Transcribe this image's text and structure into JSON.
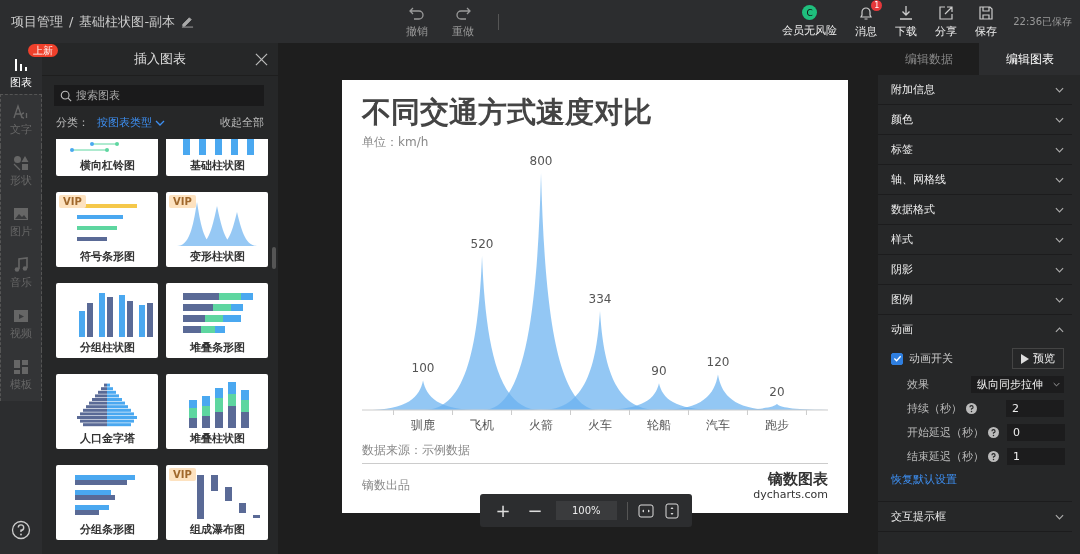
{
  "topbar": {
    "breadcrumb": [
      "项目管理",
      "基础柱状图-副本"
    ],
    "separator": "/",
    "history": [
      {
        "label": "撤销",
        "kind": "undo"
      },
      {
        "label": "重做",
        "kind": "redo"
      }
    ],
    "member": {
      "avatar": "C",
      "label": "会员无风险"
    },
    "actions": [
      {
        "label": "消息",
        "kind": "bell",
        "badge": "1"
      },
      {
        "label": "下载",
        "kind": "download"
      },
      {
        "label": "分享",
        "kind": "share"
      },
      {
        "label": "保存",
        "kind": "save"
      }
    ],
    "save_status": "22:36已保存"
  },
  "rail": {
    "badge": "上新",
    "items": [
      {
        "label": "图表",
        "kind": "chart",
        "selected": true
      },
      {
        "label": "文字",
        "kind": "text",
        "selected": false
      },
      {
        "label": "形状",
        "kind": "shape",
        "selected": false
      },
      {
        "label": "图片",
        "kind": "image",
        "selected": false
      },
      {
        "label": "音乐",
        "kind": "music",
        "selected": false
      },
      {
        "label": "视频",
        "kind": "video",
        "selected": false
      },
      {
        "label": "模板",
        "kind": "template",
        "selected": false
      }
    ]
  },
  "insert_panel": {
    "title": "插入图表",
    "search": {
      "placeholder": "搜索图表"
    },
    "category_label": "分类：",
    "category": "按图表类型",
    "collapse": "收起全部",
    "chart_rows": [
      [
        {
          "label": "横向杠铃图",
          "kind": "dumbbell"
        },
        {
          "label": "基础柱状图",
          "kind": "column"
        }
      ],
      [
        {
          "label": "符号条形图",
          "kind": "symbol",
          "badge": "VIP"
        },
        {
          "label": "变形柱状图",
          "kind": "pictorial",
          "badge": "VIP"
        }
      ],
      [
        {
          "label": "分组柱状图",
          "kind": "grouped-column"
        },
        {
          "label": "堆叠条形图",
          "kind": "stacked-bar"
        }
      ],
      [
        {
          "label": "人口金字塔",
          "kind": "pyramid"
        },
        {
          "label": "堆叠柱状图",
          "kind": "stacked-column"
        }
      ],
      [
        {
          "label": "分组条形图",
          "kind": "grouped-bar"
        },
        {
          "label": "组成瀑布图",
          "kind": "waterfall",
          "badge": "VIP"
        }
      ]
    ]
  },
  "card": {
    "title": "不同交通方式速度对比",
    "unit": "单位：km/h",
    "chart": {
      "categories": [
        "驯鹿",
        "飞机",
        "火箭",
        "火车",
        "轮船",
        "汽车",
        "跑步"
      ],
      "value_labels": [
        "100",
        "520",
        "800",
        "334",
        "90",
        "120",
        "20"
      ]
    },
    "source": "数据来源：示例数据",
    "footer": "镝数出品",
    "brand": "镝数图表",
    "brand_url": "dycharts.com"
  },
  "zoom": {
    "zoom_in": "+",
    "zoom_out": "−",
    "value": "100%"
  },
  "right_panel": {
    "tabs": [
      {
        "label": "编辑数据",
        "selected": false
      },
      {
        "label": "编辑图表",
        "selected": true
      }
    ],
    "sections": [
      {
        "label": "附加信息",
        "expanded": false
      },
      {
        "label": "颜色",
        "expanded": false
      },
      {
        "label": "标签",
        "expanded": false
      },
      {
        "label": "轴、网格线",
        "expanded": false
      },
      {
        "label": "数据格式",
        "expanded": false
      },
      {
        "label": "样式",
        "expanded": false
      },
      {
        "label": "阴影",
        "expanded": false
      },
      {
        "label": "图例",
        "expanded": false
      },
      {
        "label": "动画",
        "expanded": true
      },
      {
        "label": "交互提示框",
        "expanded": false
      }
    ],
    "animation": {
      "toggle": {
        "label": "动画开关",
        "checked": true
      },
      "preview": "预览",
      "fields": [
        {
          "label": "效果",
          "kind": "select",
          "value": "纵向同步拉伸",
          "help": false
        },
        {
          "label": "持续（秒）",
          "kind": "input",
          "value": "2",
          "help": true
        },
        {
          "label": "开始延迟（秒）",
          "kind": "input",
          "value": "0",
          "help": true
        },
        {
          "label": "结束延迟（秒）",
          "kind": "input",
          "value": "1",
          "help": true
        }
      ],
      "reset": "恢复默认设置"
    }
  }
}
